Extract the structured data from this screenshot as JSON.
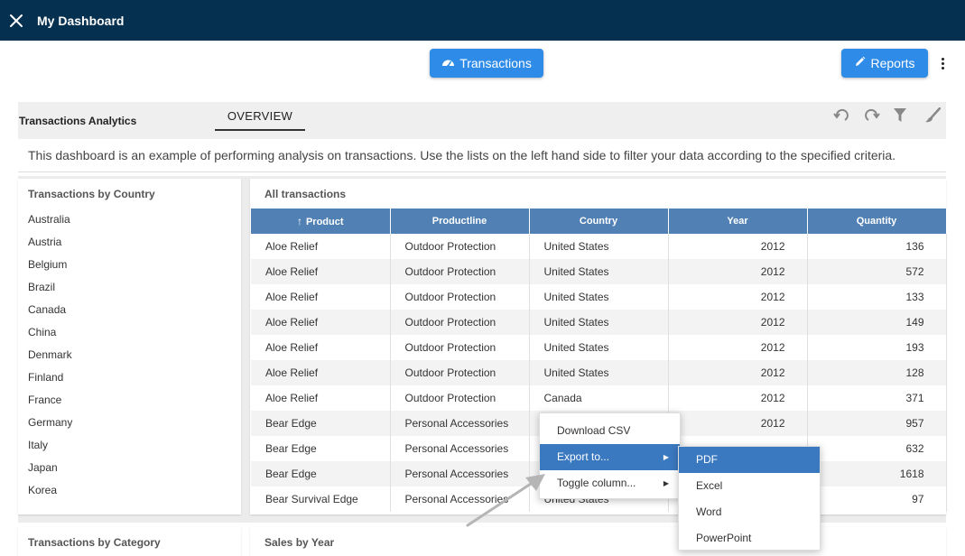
{
  "app": {
    "title": "My Dashboard"
  },
  "buttons": {
    "transactions": "Transactions",
    "reports": "Reports"
  },
  "toolbar": {
    "title": "Transactions Analytics",
    "tab": "OVERVIEW"
  },
  "description": "This dashboard is an example of performing analysis on transactions. Use the lists on the left hand side to filter your data according to the specified criteria.",
  "country_panel": {
    "title": "Transactions by Country",
    "items": [
      "Australia",
      "Austria",
      "Belgium",
      "Brazil",
      "Canada",
      "China",
      "Denmark",
      "Finland",
      "France",
      "Germany",
      "Italy",
      "Japan",
      "Korea"
    ]
  },
  "transactions_panel": {
    "title": "All transactions",
    "columns": [
      "Product",
      "Productline",
      "Country",
      "Year",
      "Quantity"
    ],
    "rows": [
      [
        "Aloe Relief",
        "Outdoor Protection",
        "United States",
        "2012",
        "136"
      ],
      [
        "Aloe Relief",
        "Outdoor Protection",
        "United States",
        "2012",
        "572"
      ],
      [
        "Aloe Relief",
        "Outdoor Protection",
        "United States",
        "2012",
        "133"
      ],
      [
        "Aloe Relief",
        "Outdoor Protection",
        "United States",
        "2012",
        "149"
      ],
      [
        "Aloe Relief",
        "Outdoor Protection",
        "United States",
        "2012",
        "193"
      ],
      [
        "Aloe Relief",
        "Outdoor Protection",
        "United States",
        "2012",
        "128"
      ],
      [
        "Aloe Relief",
        "Outdoor Protection",
        "Canada",
        "2012",
        "371"
      ],
      [
        "Bear Edge",
        "Personal Accessories",
        "U",
        "2012",
        "957"
      ],
      [
        "Bear Edge",
        "Personal Accessories",
        "U",
        "",
        "632"
      ],
      [
        "Bear Edge",
        "Personal Accessories",
        "",
        "",
        "1618"
      ],
      [
        "Bear Survival Edge",
        "Personal Accessories",
        "United States",
        "",
        "97"
      ]
    ]
  },
  "category_panel": {
    "title": "Transactions by Category"
  },
  "sales_panel": {
    "title": "Sales by Year"
  },
  "context_menu": {
    "items": [
      "Download CSV",
      "Export to...",
      "Toggle column..."
    ],
    "submenu": [
      "PDF",
      "Excel",
      "Word",
      "PowerPoint"
    ]
  },
  "colors": {
    "topbar": "#06304f",
    "button": "#2e8be8",
    "table_header": "#5080b4",
    "menu_active": "#3a78c0"
  }
}
